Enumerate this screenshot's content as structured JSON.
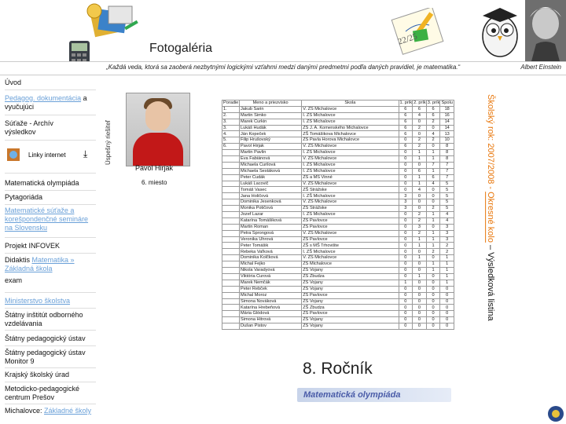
{
  "header": {
    "title": "Fotogaléria",
    "quote": "„Každá veda, ktorá sa zaoberá nezbytnými logickými vzťahmi medzi danými predmetmi podľa daných pravidiel, je matematika.“",
    "quote_author": "Albert Einstein",
    "note_label": "22/25"
  },
  "sidebar": {
    "uvod": "Úvod",
    "dokumentacia_link": "Pedagog. dokumentácia",
    "dokumentacia_rest": "a vyučujúci",
    "sutaze": "Súťaže - Archív výsledkov",
    "linky": "Linky internet",
    "matem_olymp": "Matematická olympiáda",
    "pytagoriada": "Pytagoriáda",
    "mat_sutaze": "Matematické súťaže a korešpondenčné semináre na Slovensku",
    "infovek": "Projekt INFOVEK",
    "didaktis_prefix": "Didaktis ",
    "didaktis_link": "Matematika »",
    "didaktis_school": "Základná škola",
    "exam": "exam",
    "ministerstvo": "Ministerstvo školstva",
    "siov": "Štátny inštitút odborného vzdelávania",
    "spu": "Štátny pedagogický ústav",
    "monitor": "Štátny pedagogický ústav Monitor 9",
    "ksu": "Krajský školský úrad",
    "mpc": "Metodicko-pedagogické centrum Prešov",
    "michalovce_prefix": "Michalovce: ",
    "michalovce_link": "Základné školy"
  },
  "main": {
    "vertical_left": "Úspešný riešiteľ",
    "photo_name": "Pavol Hirjak",
    "photo_place": "6. miesto",
    "rocnik": "8. Ročník",
    "olymp_banner": "Matematická olympiáda",
    "vtitle_part1": "Školský rok: 2007/2008 - ",
    "vtitle_link": "Okresné kolo",
    "vtitle_part2": " – Výsledková listina"
  },
  "table": {
    "headers": [
      "Poradie",
      "Meno a priezvisko",
      "Škola",
      "1. príklad",
      "2. príklad",
      "3. príklad",
      "Spolu"
    ],
    "rows": [
      [
        "1.",
        "Jakub Sarin",
        "V. ZŠ Michalovce",
        "6",
        "6",
        "6",
        "18"
      ],
      [
        "2.",
        "Martin Šimko",
        "I. ZŠ Michalovce",
        "6",
        "4",
        "6",
        "16"
      ],
      [
        "3.",
        "Marek Čurkin",
        "I. ZŠ Michalovce",
        "6",
        "0",
        "2",
        "14"
      ],
      [
        "3.",
        "Lukáš Hudák",
        "ZŠ J. A. Komenského Michalovce",
        "6",
        "2",
        "0",
        "14"
      ],
      [
        "4.",
        "Ján Kopeček",
        "ZŠ Tomášikova Michalovce",
        "6",
        "0",
        "4",
        "13"
      ],
      [
        "5.",
        "Filip Hrušovský",
        "ZŠ Pavla Horova Michalovce",
        "0",
        "2",
        "2",
        "10"
      ],
      [
        "6.",
        "Pavol Hirjak",
        "V. ZŠ Michalovce",
        "6",
        "2",
        "0",
        "8"
      ],
      [
        "",
        "Martin Pavlin",
        "I. ZŠ Michalovce",
        "0",
        "1",
        "1",
        "8"
      ],
      [
        "",
        "Eva Fabiánová",
        "V. ZŠ Michalovce",
        "0",
        "1",
        "1",
        "8"
      ],
      [
        "",
        "Michaela Čurilová",
        "I. ZŠ Michalovce",
        "0",
        "0",
        "7",
        "7"
      ],
      [
        "",
        "Michaela Šestáková",
        "I. ZŠ Michalovce",
        "0",
        "6",
        "1",
        "7"
      ],
      [
        "",
        "Peter Čudák",
        "ZŠ a MŠ Vinné",
        "0",
        "1",
        "6",
        "7"
      ],
      [
        "",
        "Lukáš Lacovič",
        "V. ZŠ Michalovce",
        "0",
        "1",
        "4",
        "5"
      ],
      [
        "",
        "Tomáš Vasec",
        "ZŠ Strážske",
        "0",
        "4",
        "0",
        "5"
      ],
      [
        "",
        "Jana Holičová",
        "I. ZŠ Michalovce",
        "3",
        "0",
        "0",
        "5"
      ],
      [
        "",
        "Dominika Jesenková",
        "V. ZŠ Michalovce",
        "3",
        "0",
        "0",
        "5"
      ],
      [
        "",
        "Monika Potičová",
        "ZŠ Strážske",
        "3",
        "0",
        "2",
        "5"
      ],
      [
        "",
        "Jozef Lazar",
        "I. ZŠ Michalovce",
        "0",
        "2",
        "1",
        "4"
      ],
      [
        "",
        "Katarína Tomášiková",
        "ZŠ Pavlovce",
        "0",
        "2",
        "1",
        "4"
      ],
      [
        "",
        "Martin Roman",
        "ZŠ Pavlovce",
        "0",
        "3",
        "0",
        "3"
      ],
      [
        "",
        "Petra Sprongová",
        "V. ZŠ Michalovce",
        "0",
        "2",
        "1",
        "3"
      ],
      [
        "",
        "Veronika Uhrová",
        "ZŠ Pavlovce",
        "0",
        "1",
        "1",
        "3"
      ],
      [
        "",
        "Peter Tomášik",
        "ZŠ s MŠ Trhovište",
        "0",
        "1",
        "1",
        "2"
      ],
      [
        "",
        "Rebeka Vaľková",
        "I. ZŠ Michalovce",
        "0",
        "0",
        "2",
        "2"
      ],
      [
        "",
        "Dominika Kolčková",
        "V. ZŠ Michalovce",
        "0",
        "1",
        "0",
        "1"
      ],
      [
        "",
        "Michal Fejko",
        "ZŠ Michalovce",
        "0",
        "0",
        "1",
        "1"
      ],
      [
        "",
        "Nikola Varadyová",
        "ZŠ Vojany",
        "0",
        "0",
        "1",
        "1"
      ],
      [
        "",
        "Viktória Čurová",
        "ZŠ Zbudza",
        "0",
        "1",
        "0",
        "1"
      ],
      [
        "",
        "Marek Nemčák",
        "ZŠ Vojany",
        "1",
        "0",
        "0",
        "1"
      ],
      [
        "",
        "Peter Rebček",
        "ZŠ Vojany",
        "0",
        "0",
        "0",
        "0"
      ],
      [
        "",
        "Michal Moroz",
        "ZŠ Pavlovce",
        "0",
        "0",
        "0",
        "0"
      ],
      [
        "",
        "Simona Nováková",
        "ZŠ Vojany",
        "0",
        "0",
        "0",
        "0"
      ],
      [
        "",
        "Katarína Hrebeňová",
        "ZŠ Zbudza",
        "0",
        "0",
        "0",
        "0"
      ],
      [
        "",
        "Mária Glódová",
        "ZŠ Pavlovce",
        "0",
        "0",
        "0",
        "0"
      ],
      [
        "",
        "Simona Hitrová",
        "ZŠ Vojany",
        "0",
        "0",
        "0",
        "0"
      ],
      [
        "",
        "Dušan Pistov",
        "ZŠ Vojany",
        "0",
        "0",
        "0",
        "0"
      ]
    ]
  },
  "colors": {
    "link": "#6aa0d8",
    "accent_orange": "#e8760a",
    "shirt": "#c21818",
    "banner_text": "#4a5ca8"
  }
}
